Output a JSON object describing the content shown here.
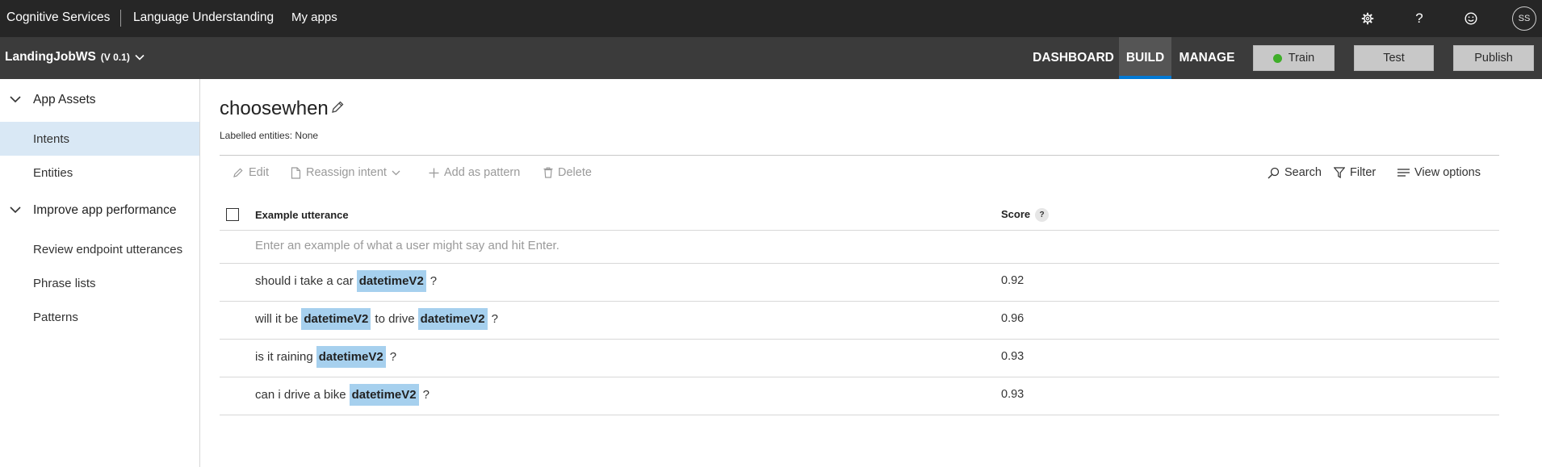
{
  "topbar": {
    "brand": "Cognitive Services",
    "product": "Language Understanding",
    "my_apps": "My apps",
    "icons": [
      "gear-icon",
      "help-icon",
      "feedback-smiley-icon"
    ],
    "avatar_initials": "SS"
  },
  "appbar": {
    "app_name": "LandingJobWS",
    "app_version": "(V 0.1)",
    "tabs": [
      {
        "label": "DASHBOARD",
        "active": false
      },
      {
        "label": "BUILD",
        "active": true
      },
      {
        "label": "MANAGE",
        "active": false
      }
    ],
    "train_label": "Train",
    "train_status_color": "#3fae29",
    "test_label": "Test",
    "publish_label": "Publish",
    "accent_color": "#0078d4"
  },
  "sidebar": {
    "groups": [
      {
        "label": "App Assets",
        "items": [
          {
            "label": "Intents",
            "active": true
          },
          {
            "label": "Entities",
            "active": false
          }
        ]
      },
      {
        "label": "Improve app performance",
        "items": [
          {
            "label": "Review endpoint utterances",
            "active": false
          },
          {
            "label": "Phrase lists",
            "active": false
          },
          {
            "label": "Patterns",
            "active": false
          }
        ]
      }
    ]
  },
  "main": {
    "intent_name": "choosewhen",
    "labelled_entities": "Labelled entities: None",
    "toolbar": {
      "edit": "Edit",
      "reassign": "Reassign intent",
      "add_pattern": "Add as pattern",
      "delete": "Delete",
      "search": "Search",
      "filter": "Filter",
      "view_options": "View options"
    },
    "table": {
      "col_utterance": "Example utterance",
      "col_score": "Score",
      "score_help": "?",
      "new_placeholder": "Enter an example of what a user might say and hit Enter.",
      "rows": [
        {
          "parts": [
            {
              "t": "should i take a car",
              "entity": false
            },
            {
              "t": "datetimeV2",
              "entity": true
            },
            {
              "t": "?",
              "entity": false
            }
          ],
          "score": "0.92"
        },
        {
          "parts": [
            {
              "t": "will it be",
              "entity": false
            },
            {
              "t": "datetimeV2",
              "entity": true
            },
            {
              "t": "to drive",
              "entity": false
            },
            {
              "t": "datetimeV2",
              "entity": true
            },
            {
              "t": "?",
              "entity": false
            }
          ],
          "score": "0.96"
        },
        {
          "parts": [
            {
              "t": "is it raining",
              "entity": false
            },
            {
              "t": "datetimeV2",
              "entity": true
            },
            {
              "t": "?",
              "entity": false
            }
          ],
          "score": "0.93"
        },
        {
          "parts": [
            {
              "t": "can i drive a bike",
              "entity": false
            },
            {
              "t": "datetimeV2",
              "entity": true
            },
            {
              "t": "?",
              "entity": false
            }
          ],
          "score": "0.93"
        }
      ]
    }
  }
}
